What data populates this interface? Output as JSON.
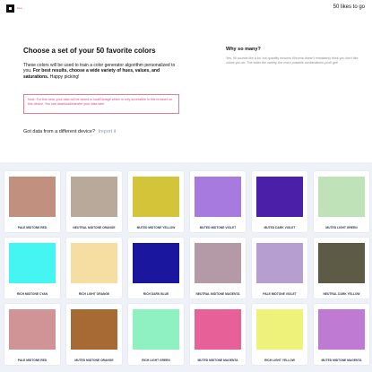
{
  "header": {
    "beta": "beta",
    "likes_to_go": "50 likes to go"
  },
  "main": {
    "title": "Choose a set of your 50 favorite colors",
    "intro_plain": "These colors will be used to train a color generator algorithm personalized to you. ",
    "intro_bold": "For best results, choose a wide variety of hues, values, and saturations.",
    "intro_tail": " Happy picking!",
    "notice": "Note: For this beta, your data will be saved in localStorage which is only accessible in this browser on this device. You can download/transfer your data later.",
    "import_prompt": "Got data from a different device?",
    "import_link": "Import it"
  },
  "aside": {
    "title": "Why so many?",
    "text": "Yes, 50 sounds like a lot, but quantity ensures Khroma doesn't mistakenly think you don't like colors you do. The wider the variety, the more possible combinations you'll get!"
  },
  "swatches": [
    {
      "label": "PALE MIDTONE RED",
      "color": "#c2907e"
    },
    {
      "label": "NEUTRAL MIDTONE ORANGE",
      "color": "#b8a99a"
    },
    {
      "label": "MUTED MIDTONE YELLOW",
      "color": "#d4c43a"
    },
    {
      "label": "MUTED MIDTONE VIOLET",
      "color": "#a77ae0"
    },
    {
      "label": "MUTED DARK VIOLET",
      "color": "#4b1fa8"
    },
    {
      "label": "MUTED LIGHT GREEN",
      "color": "#bfe2b8"
    },
    {
      "label": "RICH MIDTONE CYAN",
      "color": "#45f5f2"
    },
    {
      "label": "RICH LIGHT ORANGE",
      "color": "#f6dea2"
    },
    {
      "label": "RICH DARK BLUE",
      "color": "#1a169e"
    },
    {
      "label": "NEUTRAL MIDTONE MAGENTA",
      "color": "#b499a6"
    },
    {
      "label": "PALE MIDTONE VIOLET",
      "color": "#b79ed0"
    },
    {
      "label": "NEUTRAL DARK YELLOW",
      "color": "#5d5a45"
    },
    {
      "label": "PALE MIDTONE RED",
      "color": "#d09497"
    },
    {
      "label": "MUTED MIDTONE ORANGE",
      "color": "#a76a34"
    },
    {
      "label": "RICH LIGHT GREEN",
      "color": "#8ff0c1"
    },
    {
      "label": "MUTED MIDTONE MAGENTA",
      "color": "#e86098"
    },
    {
      "label": "RICH LIGHT YELLOW",
      "color": "#eef27a"
    },
    {
      "label": "MUTED MIDTONE MAGENTA",
      "color": "#bf7ad3"
    }
  ]
}
